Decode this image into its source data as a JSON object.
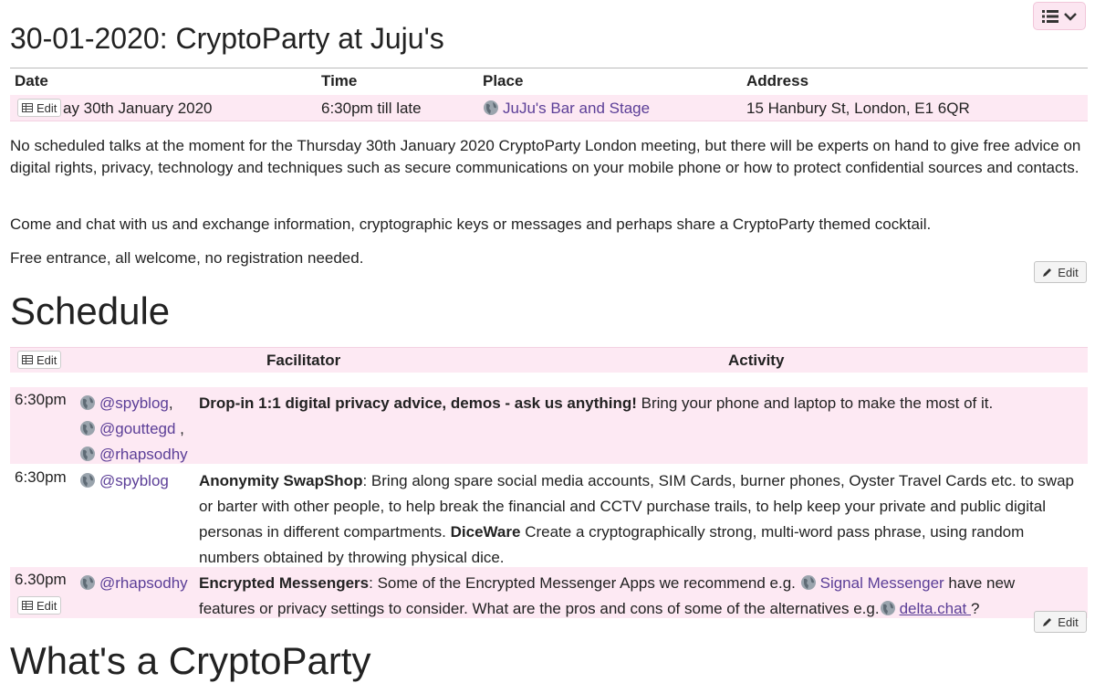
{
  "page": {
    "title": "30-01-2020: CryptoParty at Juju's"
  },
  "event": {
    "headers": {
      "date": "Date",
      "time": "Time",
      "place": "Place",
      "address": "Address"
    },
    "row": {
      "date": "ay 30th January 2020",
      "time": "6:30pm till late",
      "place": "JuJu's Bar and Stage",
      "address": "15 Hanbury St, London, E1 6QR"
    }
  },
  "edit_label": "Edit",
  "description": [
    "No scheduled talks at the moment for the Thursday 30th January 2020 CryptoParty London meeting, but there will be experts on hand to give free advice on digital rights, privacy, technology and techniques such as secure communications on your mobile phone or how to protect confidential sources and contacts.",
    "Come and chat with us and exchange information, cryptographic keys or messages and perhaps share a CryptoParty themed cocktail.",
    "Free entrance, all welcome, no registration needed."
  ],
  "schedule": {
    "heading": "Schedule",
    "headers": {
      "facilitator": "Facilitator",
      "activity": "Activity"
    },
    "rows": [
      {
        "time": "6:30pm",
        "facilitators": [
          "@spyblog",
          "@gouttegd",
          "@rhapsodhy"
        ],
        "sep1": ",",
        "sep2": " ,",
        "title": "Drop-in 1:1 digital privacy advice, demos - ask us anything!",
        "text": " Bring your phone and laptop to make the most of it."
      },
      {
        "time": "6:30pm",
        "facilitators": [
          "@spyblog"
        ],
        "title": "Anonymity SwapShop",
        "text": ": Bring along spare social media accounts, SIM Cards, burner phones, Oyster Travel Cards etc. to swap or barter with other people, to help break the financial and CCTV purchase trails, to help keep your private and public digital personas in different compartments. ",
        "title2": "DiceWare",
        "text2": " Create a cryptographically strong, multi-word pass phrase, using random numbers obtained by throwing physical dice."
      },
      {
        "time": "6.30pm",
        "facilitators": [
          "@rhapsodhy"
        ],
        "title": "Encrypted Messengers",
        "text": ": Some of the Encrypted Messenger Apps we recommend e.g. ",
        "link1": "Signal Messenger",
        "text2": " have new features or privacy settings to consider. What are the pros and cons of some of the alternatives e.g.",
        "link2": "delta.chat ",
        "text3": "?"
      }
    ]
  },
  "next_heading": "What's a CryptoParty",
  "colors": {
    "row_pink": "#fde9f3",
    "link": "#5b3e97"
  }
}
